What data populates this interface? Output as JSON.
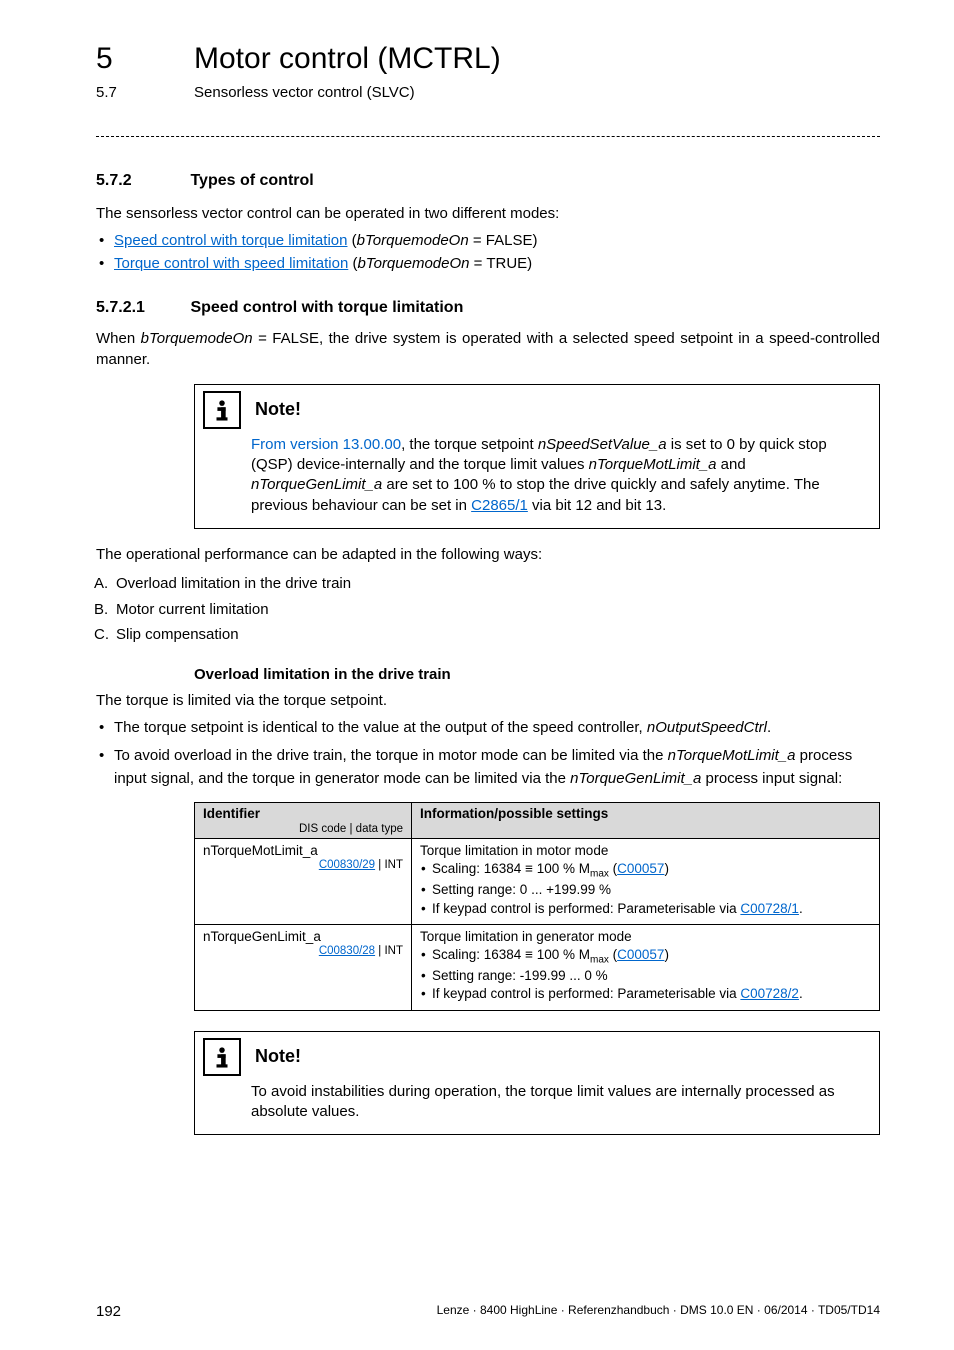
{
  "header": {
    "chapter_num": "5",
    "chapter_title": "Motor control (MCTRL)",
    "section_num": "5.7",
    "section_title": "Sensorless vector control (SLVC)"
  },
  "sec572": {
    "num": "5.7.2",
    "title": "Types of control",
    "intro": "The sensorless vector control can be operated in two different modes:",
    "bullets": [
      {
        "link": "Speed control with torque limitation",
        "after_open": " (",
        "ital": "bTorquemodeOn",
        "after_close": " = FALSE)"
      },
      {
        "link": "Torque control with speed limitation",
        "after_open": " (",
        "ital": "bTorquemodeOn",
        "after_close": " = TRUE)"
      }
    ]
  },
  "sec5721": {
    "num": "5.7.2.1",
    "title": "Speed control with torque limitation",
    "para_pre": "When ",
    "para_ital": "bTorquemodeOn",
    "para_post": " = FALSE, the drive system is operated with a selected speed setpoint in a speed-controlled manner."
  },
  "note1": {
    "title": "Note!",
    "l1_blue": "From version 13.00.00",
    "l1_rest": ", the torque setpoint ",
    "l1_ital": "nSpeedSetValue_a",
    "l1_end": " is set to 0 by quick stop (QSP) device-internally and the torque limit values ",
    "l2_ital1": "nTorqueMotLimit_a",
    "l2_mid": " and ",
    "l3_ital": "nTorqueGenLimit_a",
    "l3_mid": " are set to 100 % to stop the drive quickly and safely anytime. The previous behaviour can be set in ",
    "l3_link": "C2865/1",
    "l3_end": " via bit 12 and bit 13."
  },
  "perf_intro": "The operational performance can be adapted in the following ways:",
  "alpha": [
    {
      "marker": "A.",
      "text": "Overload limitation in the drive train"
    },
    {
      "marker": "B.",
      "text": "Motor current limitation"
    },
    {
      "marker": "C.",
      "text": "Slip compensation"
    }
  ],
  "overload": {
    "heading": "Overload limitation in the drive train",
    "p1": "The torque is limited via the torque setpoint.",
    "b1_pre": "The torque setpoint is identical to the value at the output of the speed controller, ",
    "b1_ital": "nOutputSpeedCtrl",
    "b1_post": ".",
    "b2_pre": "To avoid overload in the drive train, the torque in motor mode can be limited via the ",
    "b2_ital1": "nTorqueMotLimit_a",
    "b2_mid": " process input signal, and the torque in generator mode can be limited via the ",
    "b2_ital2": "nTorqueGenLimit_a",
    "b2_post": " process input signal:"
  },
  "table": {
    "head_id": "Identifier",
    "head_id_sub": "DIS code | data type",
    "head_info": "Information/possible settings",
    "rows": [
      {
        "id_name": "nTorqueMotLimit_a",
        "id_code": "C00830/29",
        "id_type": " | INT",
        "info_title": "Torque limitation in motor mode",
        "b_scale_pre": "Scaling: 16384 ≡ 100 % M",
        "b_scale_sub": "max",
        "b_scale_open": " (",
        "b_scale_link": "C00057",
        "b_scale_close": ")",
        "b_range": "Setting range: 0 ... +199.99 %",
        "b_kp_pre": "If keypad control is performed: Parameterisable via ",
        "b_kp_link": "C00728/1",
        "b_kp_post": "."
      },
      {
        "id_name": "nTorqueGenLimit_a",
        "id_code": "C00830/28",
        "id_type": " | INT",
        "info_title": "Torque limitation in generator mode",
        "b_scale_pre": "Scaling: 16384 ≡ 100 % M",
        "b_scale_sub": "max",
        "b_scale_open": " (",
        "b_scale_link": "C00057",
        "b_scale_close": ")",
        "b_range": "Setting range: -199.99 ... 0 %",
        "b_kp_pre": "If keypad control is performed: Parameterisable via ",
        "b_kp_link": "C00728/2",
        "b_kp_post": "."
      }
    ]
  },
  "note2": {
    "title": "Note!",
    "body": "To avoid instabilities during operation, the torque limit values are internally processed as absolute values."
  },
  "footer": {
    "page": "192",
    "right": "Lenze · 8400 HighLine · Referenzhandbuch · DMS 10.0 EN · 06/2014 · TD05/TD14"
  }
}
